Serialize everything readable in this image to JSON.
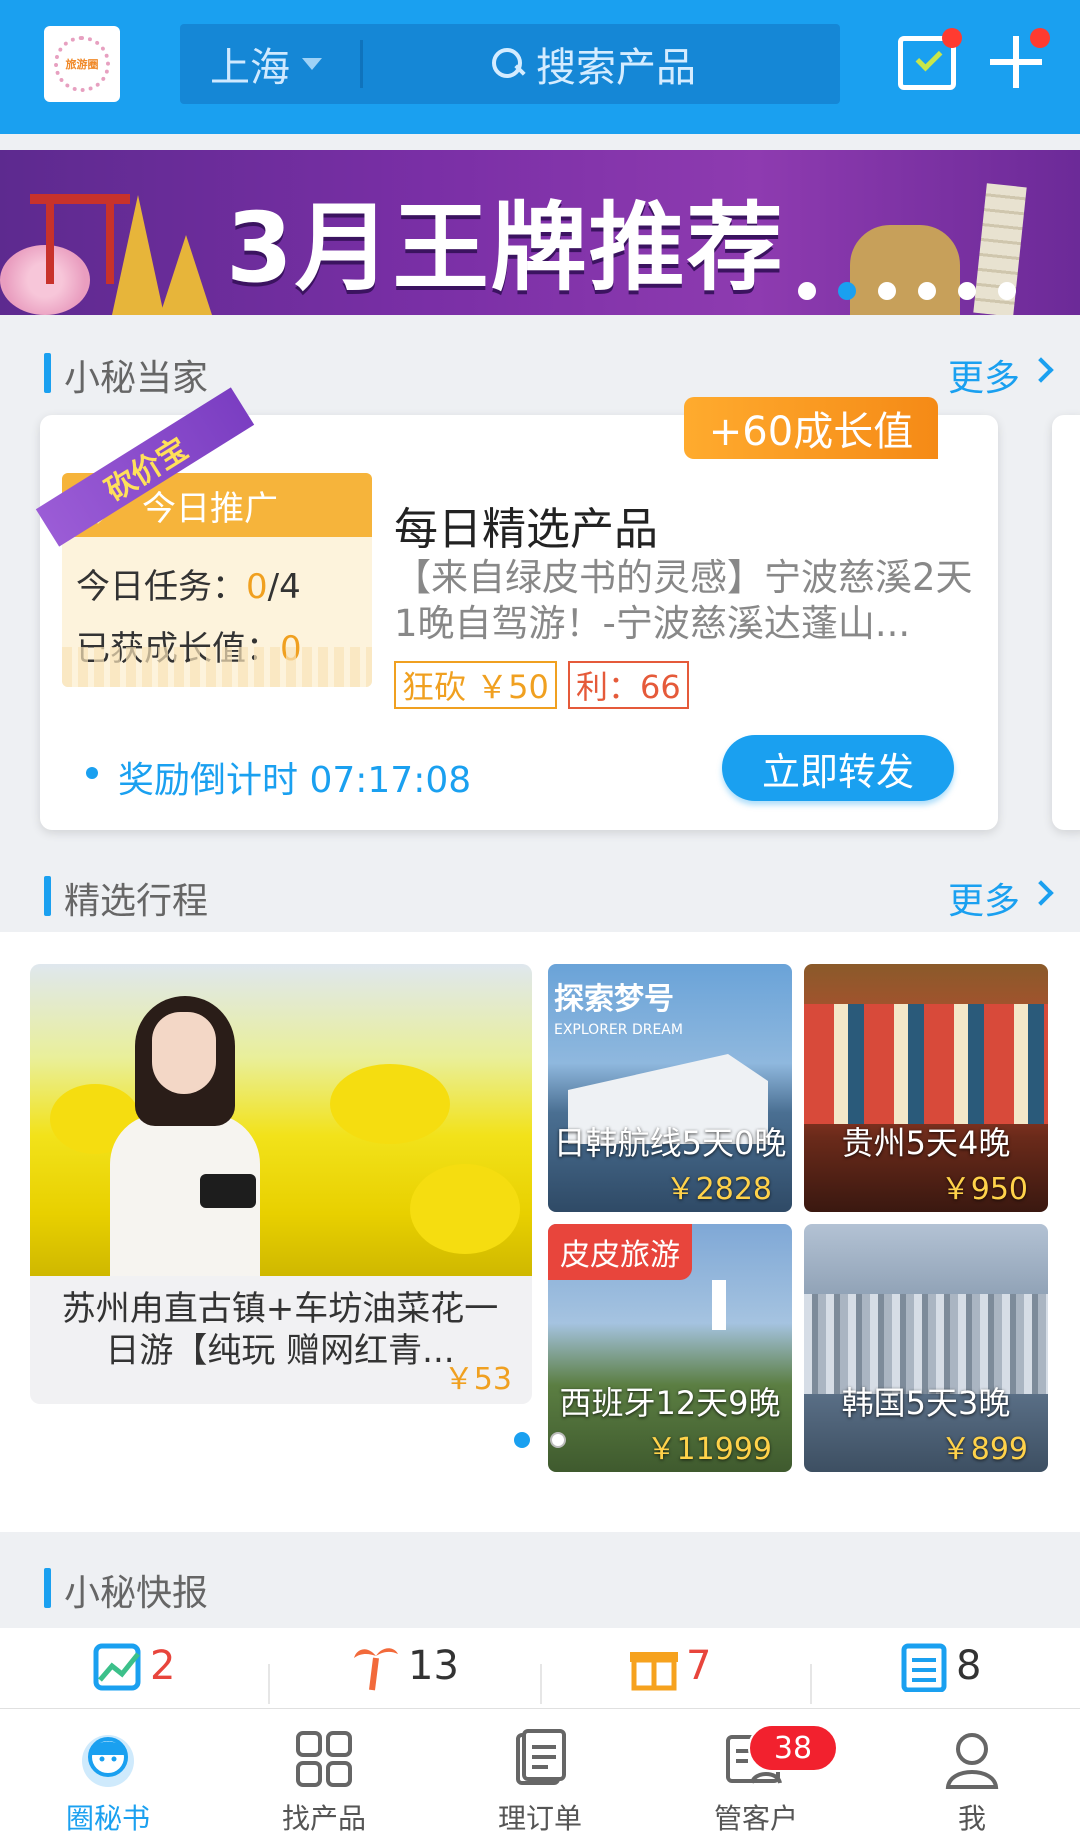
{
  "header": {
    "city": "上海",
    "search_placeholder": "搜索产品",
    "logo_text": "旅游圈"
  },
  "banner": {
    "title": "3月王牌推荐",
    "slide_count": 6,
    "active_slide": 2
  },
  "section_tasks": {
    "title": "小秘当家",
    "more": "更多"
  },
  "task_card": {
    "ribbon": "砍价宝",
    "growth_reward": "+60成长值",
    "promo_header": "今日推广",
    "task_label": "今日任务：",
    "task_done": "0",
    "task_total": "/4",
    "growth_label": "已获成长值：",
    "growth_value": "0",
    "product_title": "每日精选产品",
    "product_desc": "【来自绿皮书的灵感】宁波慈溪2天1晚自驾游！-宁波慈溪达蓬山...",
    "tag_discount": "狂砍 ￥50",
    "tag_profit": "利：66",
    "countdown": "奖励倒计时 07:17:08",
    "share_button": "立即转发"
  },
  "section_itin": {
    "title": "精选行程",
    "more": "更多"
  },
  "itineraries": {
    "featured": {
      "title": "苏州甪直古镇+车坊油菜花一日游【纯玩 赠网红青...",
      "price": "￥53"
    },
    "tiles": [
      {
        "name": "日韩航线5天0晚",
        "price": "￥2828",
        "brand": "探索梦号",
        "brand_sub": "EXPLORER DREAM"
      },
      {
        "name": "贵州5天4晚",
        "price": "￥950"
      },
      {
        "name": "西班牙12天9晚",
        "price": "￥11999",
        "badge": "皮皮旅游"
      },
      {
        "name": "韩国5天3晚",
        "price": "￥899"
      }
    ]
  },
  "section_news": {
    "title": "小秘快报"
  },
  "stats": [
    {
      "icon": "chart-icon",
      "value": "2"
    },
    {
      "icon": "palm-tree-icon",
      "value": "13"
    },
    {
      "icon": "gift-icon",
      "value": "7"
    },
    {
      "icon": "list-icon",
      "value": "8"
    }
  ],
  "tabbar": {
    "tabs": [
      {
        "label": "圈秘书"
      },
      {
        "label": "找产品"
      },
      {
        "label": "理订单"
      },
      {
        "label": "管客户"
      },
      {
        "label": "我"
      }
    ],
    "customer_badge": "38"
  },
  "colors": {
    "primary": "#1aa0f0",
    "accent_orange": "#f0a020",
    "alert_red": "#e8453c",
    "banner_purple": "#7a2fa6"
  }
}
